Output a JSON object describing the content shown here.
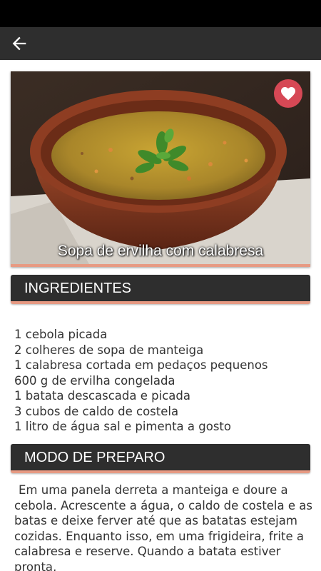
{
  "recipe": {
    "title": "Sopa de ervilha com calabresa"
  },
  "sections": {
    "ingredients_title": "INGREDIENTES",
    "preparation_title": "MODO DE PREPARO"
  },
  "ingredients": [
    "1 cebola picada",
    "2 colheres de sopa de manteiga",
    "1 calabresa cortada em pedaços pequenos",
    "600 g de ervilha congelada",
    "1 batata descascada e picada",
    "3 cubos de caldo de costela",
    "1 litro de água sal e pimenta a gosto"
  ],
  "preparation": "Em uma panela derreta a manteiga e doure a cebola. Acrescente a água, o caldo de costela e as batas e deixe ferver até que as batatas estejam cozidas. Enquanto isso, em uma frigideira, frite a calabresa e reserve. Quando a batata estiver pronta,",
  "icons": {
    "back": "arrow-left-icon",
    "favorite": "heart-icon"
  },
  "colors": {
    "app_bar": "#2e2e2e",
    "status_bar": "#000000",
    "accent": "#e79a83",
    "favorite": "#d64855",
    "text": "#333333"
  }
}
